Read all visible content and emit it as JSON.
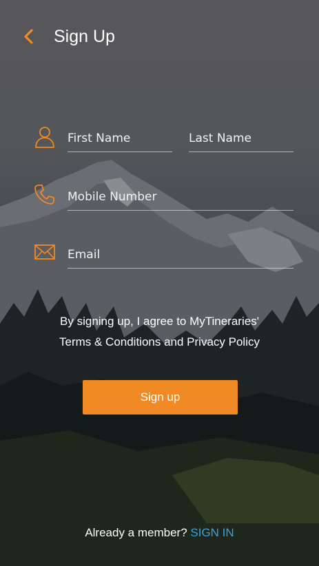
{
  "header": {
    "title": "Sign Up",
    "back_icon": "chevron-left-icon"
  },
  "form": {
    "first_name_placeholder": "First Name",
    "last_name_placeholder": "Last Name",
    "mobile_placeholder": "Mobile Number",
    "email_placeholder": "Email",
    "icons": [
      "user-icon",
      "phone-icon",
      "envelope-icon"
    ]
  },
  "agreement": {
    "line1": "By signing up, I agree to MyTineraries'",
    "line2": "Terms & Conditions and Privacy Policy"
  },
  "signup_button": {
    "label": "Sign up"
  },
  "footer": {
    "prompt": "Already a member?",
    "signin_label": "SIGN IN"
  },
  "colors": {
    "accent": "#f08a24",
    "link": "#3aa1e2",
    "text": "#ffffff"
  }
}
